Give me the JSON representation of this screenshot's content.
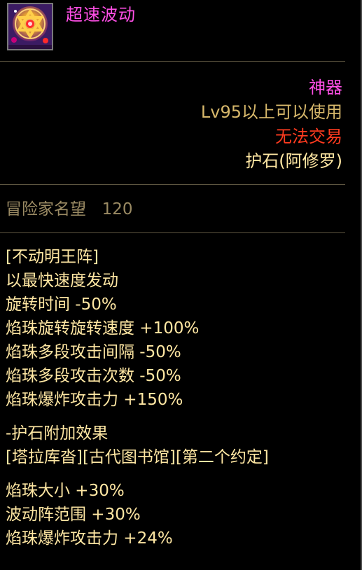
{
  "item": {
    "name": "超速波动",
    "icon": "hexagram-star-icon",
    "rarity": "神器",
    "level_requirement": "Lv95以上可以使用",
    "trade_status": "无法交易",
    "slot_type": "护石(阿修罗)",
    "reputation_label": "冒险家名望",
    "reputation_value": "120"
  },
  "effects": {
    "skill_name": "[不动明王阵]",
    "line_1": "以最快速度发动",
    "line_2": "旋转时间 -50%",
    "line_3": "焰珠旋转旋转速度 +100%",
    "line_4": "焰珠多段攻击间隔 -50%",
    "line_5": "焰珠多段攻击次数 -50%",
    "line_6": "焰珠爆炸攻击力 +150%"
  },
  "bonus": {
    "title": "-护石附加效果",
    "sources": "[塔拉库沓][古代图书馆][第二个约定]",
    "line_1": "焰珠大小 +30%",
    "line_2": "波动阵范围 +30%",
    "line_3": "焰珠爆炸攻击力 +24%"
  },
  "colors": {
    "name": "#ff4fe6",
    "rarity": "#ff4fe6",
    "level": "#d7b86b",
    "trade": "#ff3b1f",
    "text": "#ffe7a3",
    "reputation": "#9a8a63",
    "divider": "#5d5540"
  }
}
